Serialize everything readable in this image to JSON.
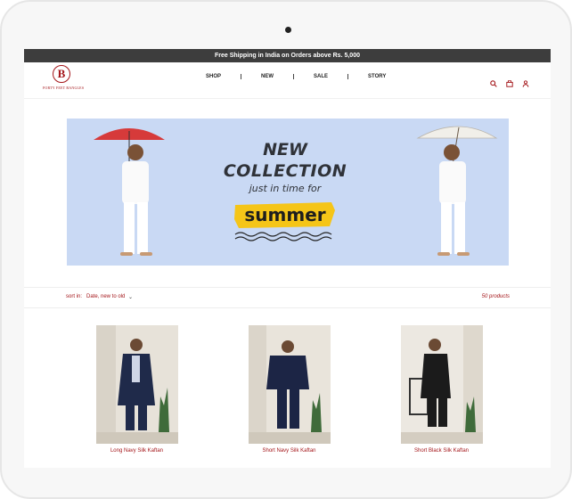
{
  "announcement": "Free Shipping in India on Orders above Rs. 5,000",
  "brand": {
    "mark": "B",
    "name": "FORTY FEET BANGLES"
  },
  "nav": [
    {
      "label": "SHOP"
    },
    {
      "label": "NEW"
    },
    {
      "label": "SALE"
    },
    {
      "label": "STORY"
    }
  ],
  "header_icons": [
    "search-icon",
    "cart-icon",
    "account-icon"
  ],
  "banner": {
    "line1": "NEW",
    "line2": "COLLECTION",
    "line3": "just in time for",
    "line4": "summer"
  },
  "sort": {
    "label": "sort in:",
    "value": "Date, new to old",
    "count": "50 products"
  },
  "products": [
    {
      "title": "Long Navy Silk Kaftan"
    },
    {
      "title": "Short Navy Silk Kaftan"
    },
    {
      "title": "Short Black Silk Kaftan"
    }
  ],
  "colors": {
    "accent": "#a4161a",
    "announce_bg": "#3d3d3d",
    "banner_bg": "#c9d9f4",
    "highlight": "#f5c518"
  }
}
